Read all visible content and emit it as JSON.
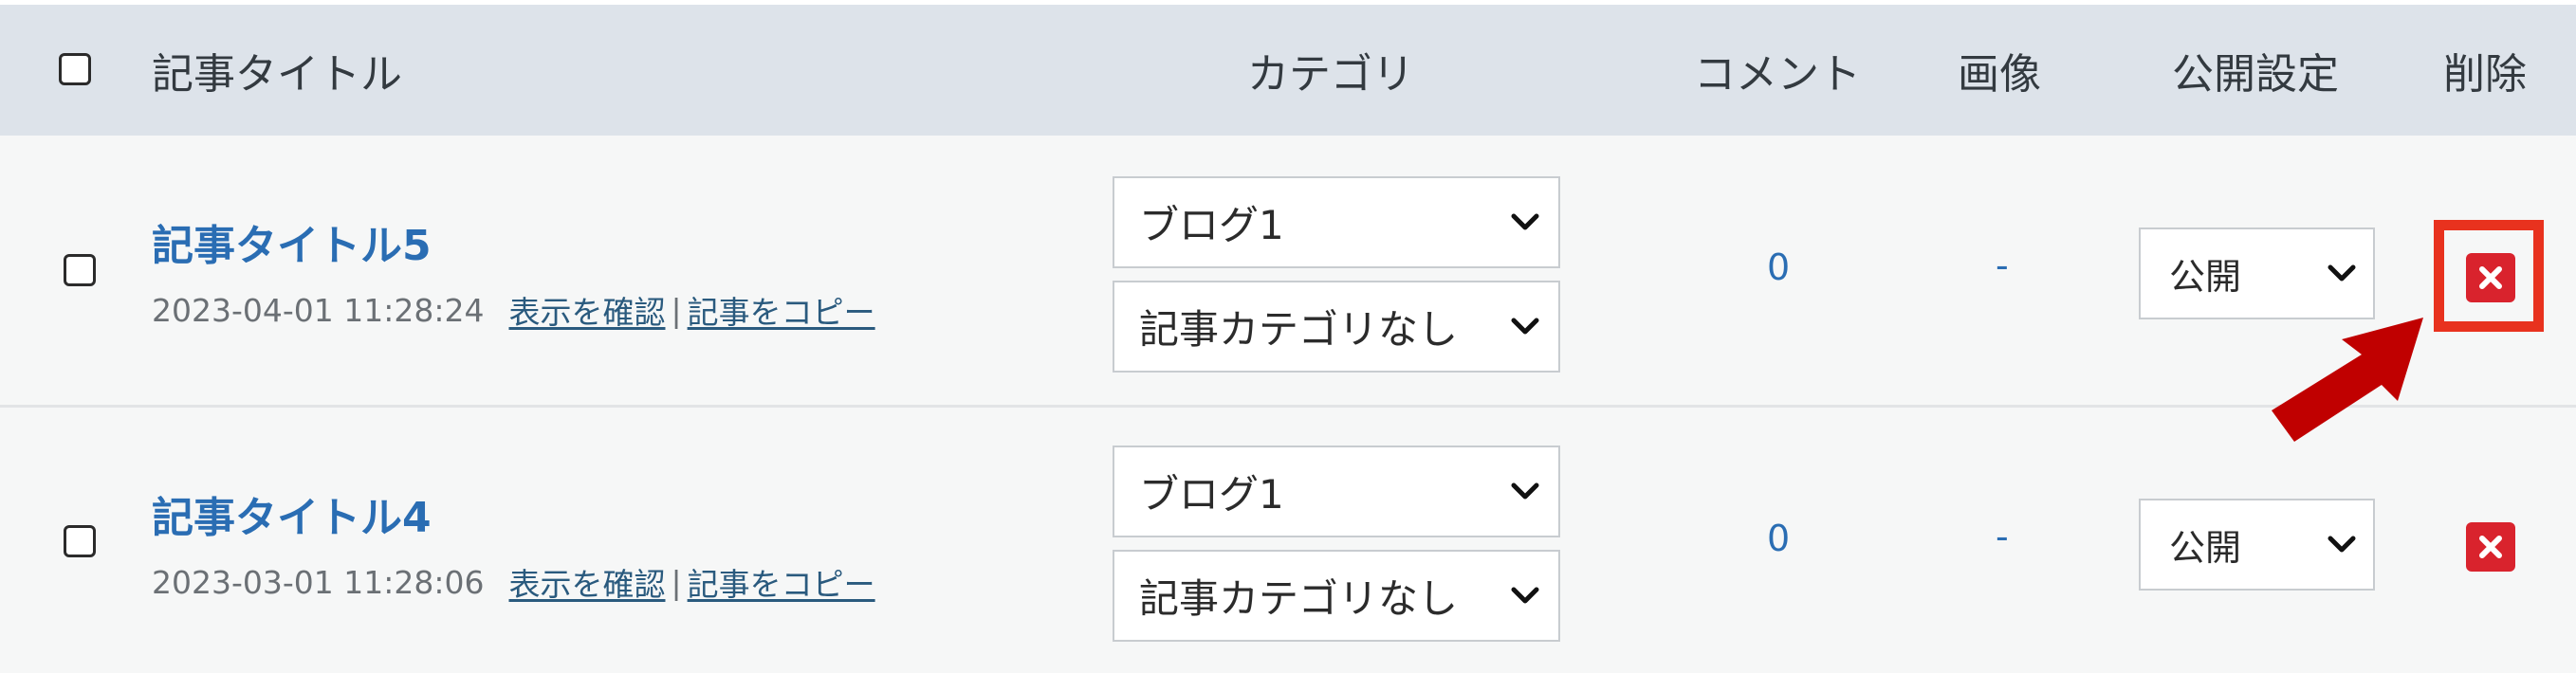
{
  "header": {
    "title_col": "記事タイトル",
    "category_col": "カテゴリ",
    "comment_col": "コメント",
    "image_col": "画像",
    "status_col": "公開設定",
    "delete_col": "削除"
  },
  "rows": [
    {
      "title": "記事タイトル5",
      "date": "2023-04-01 11:28:24",
      "view_link": "表示を確認",
      "separator": "|",
      "copy_link": "記事をコピー",
      "blog": "ブログ1",
      "category": "記事カテゴリなし",
      "comments": "0",
      "image": "-",
      "status": "公開"
    },
    {
      "title": "記事タイトル4",
      "date": "2023-03-01 11:28:06",
      "view_link": "表示を確認",
      "separator": "|",
      "copy_link": "記事をコピー",
      "blog": "ブログ1",
      "category": "記事カテゴリなし",
      "comments": "0",
      "image": "-",
      "status": "公開"
    }
  ],
  "colors": {
    "header_bg": "#dde3ea",
    "row_bg": "#f6f7f7",
    "link": "#2a6db3",
    "delete": "#d9232d",
    "highlight": "#e8321e",
    "arrow": "#c00000"
  },
  "icons": [
    "checkbox-icon",
    "chevron-down-icon",
    "delete-x-icon",
    "pointer-arrow-icon"
  ]
}
